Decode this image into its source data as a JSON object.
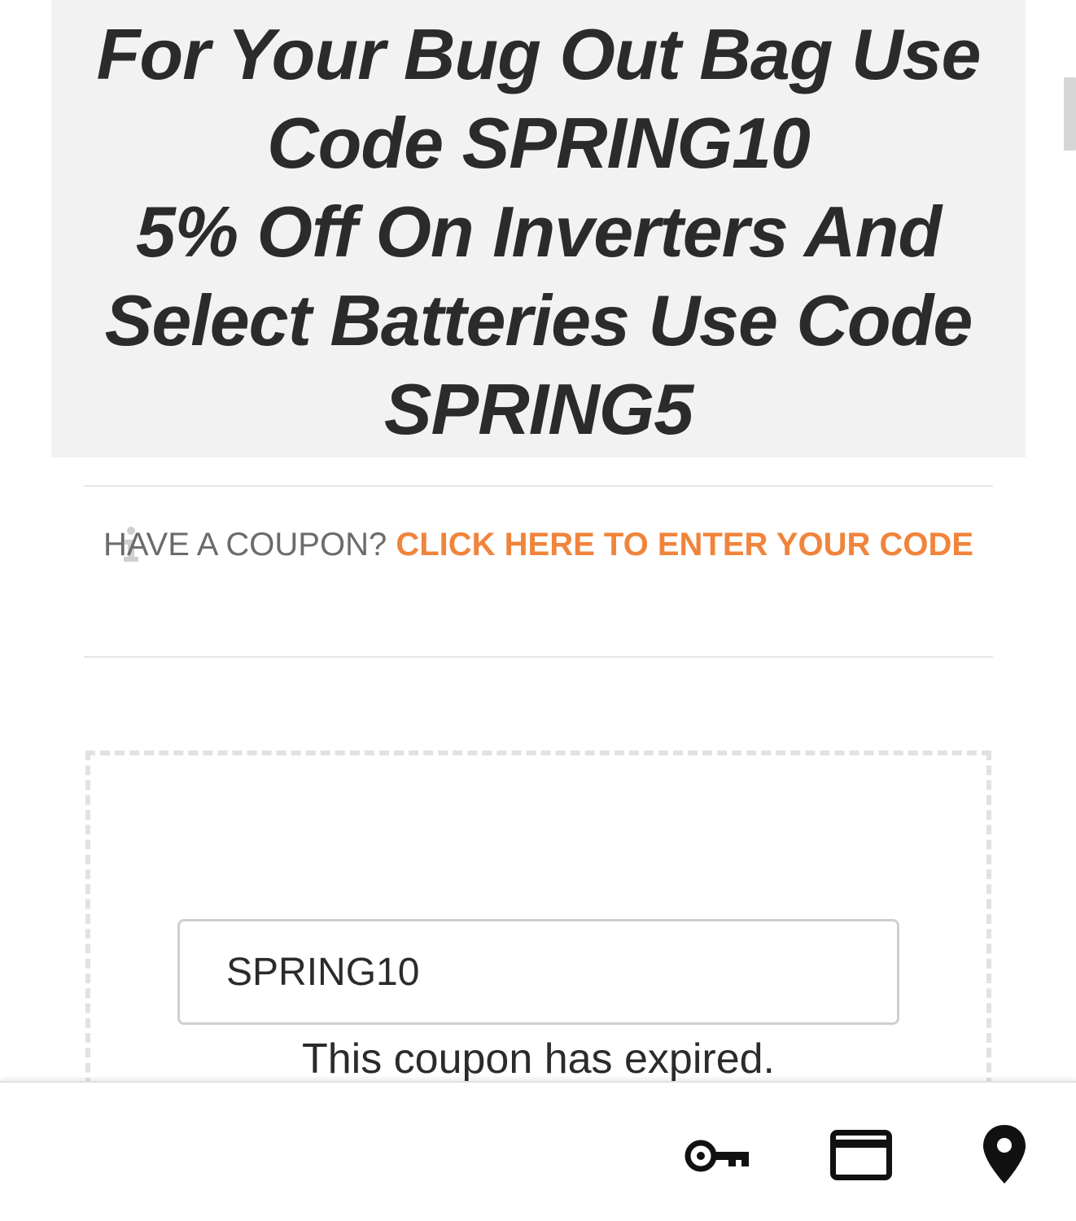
{
  "promo": {
    "lines": [
      "For Your Bug Out Bag Use",
      "Code SPRING10",
      "5% Off On Inverters And",
      "Select Batteries Use Code",
      "SPRING5"
    ]
  },
  "coupon_notice": {
    "icon": "info-icon",
    "prefix": "HAVE A COUPON?",
    "link_text": "CLICK HERE TO ENTER YOUR CODE",
    "link_color": "#f0843c"
  },
  "coupon_form": {
    "code_value": "SPRING10",
    "status_message": "This coupon has expired."
  },
  "bottom_bar": {
    "icons": [
      "key-icon",
      "credit-card-icon",
      "location-pin-icon"
    ]
  }
}
